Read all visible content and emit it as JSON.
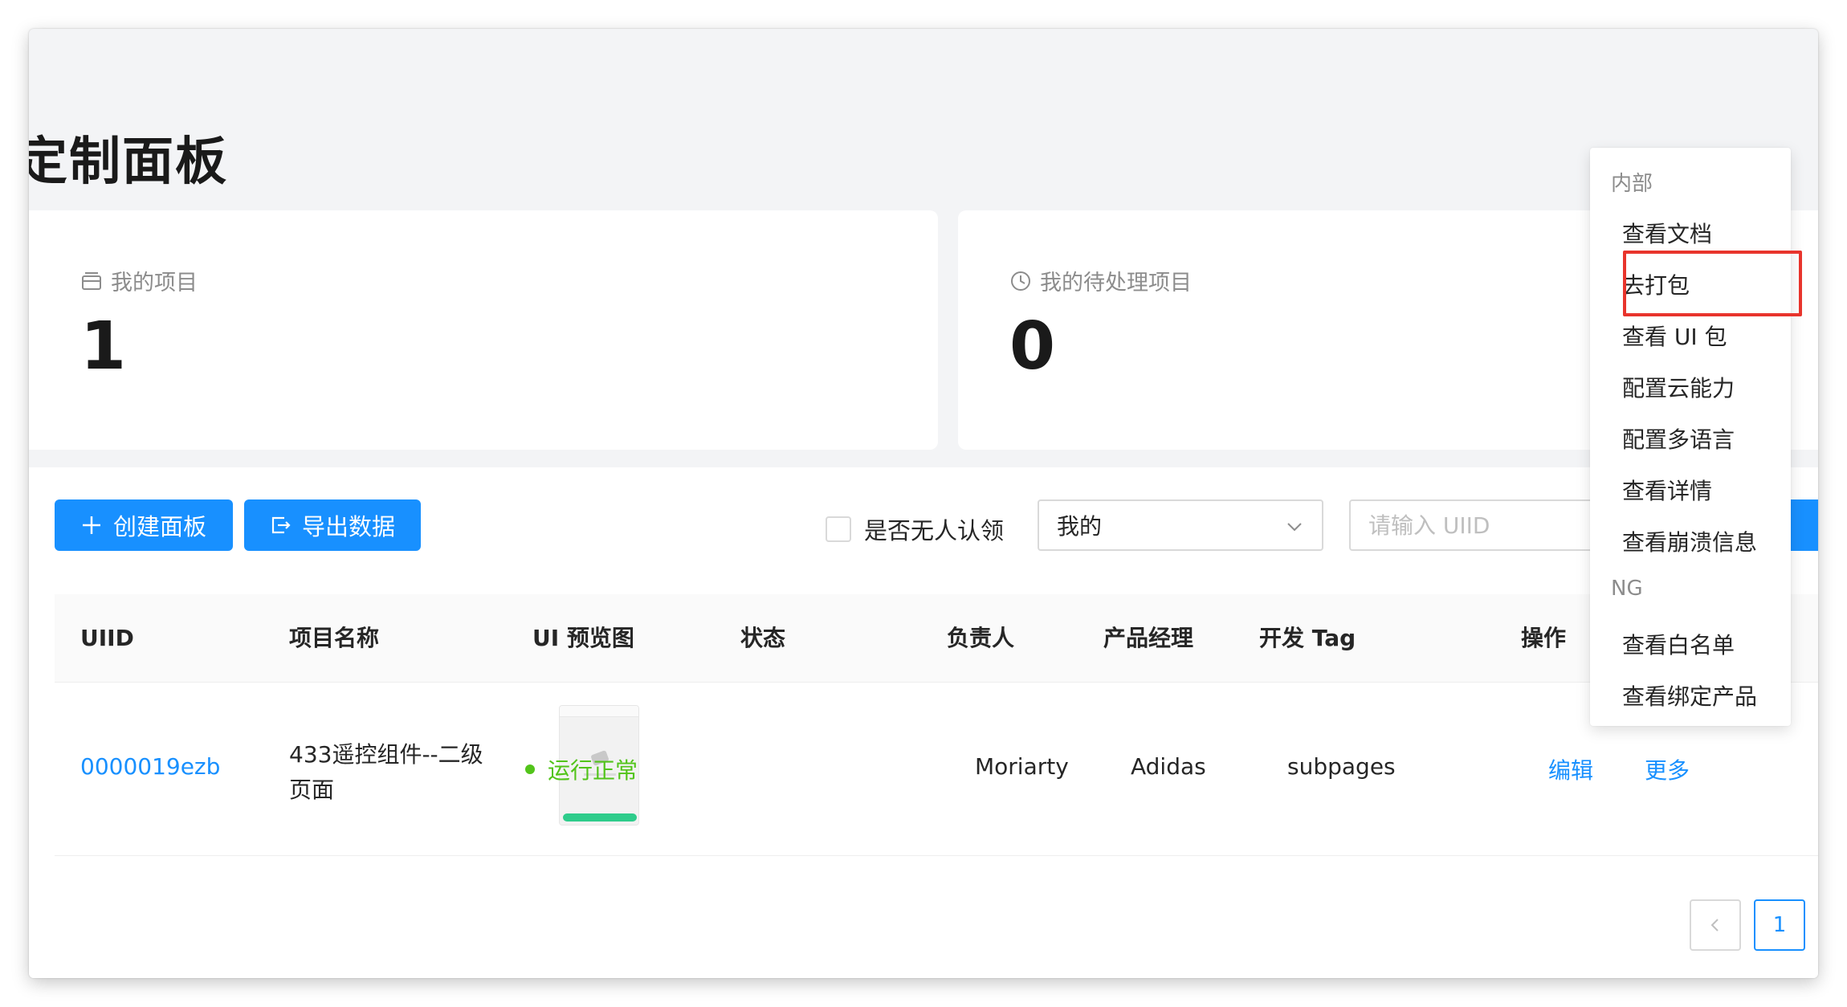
{
  "page": {
    "title": "定制面板"
  },
  "stats": {
    "my_projects": {
      "label": "我的项目",
      "value": "1"
    },
    "pending": {
      "label": "我的待处理项目",
      "value": "0"
    }
  },
  "toolbar": {
    "create_label": "创建面板",
    "export_label": "导出数据",
    "unclaimed_label": "是否无人认领",
    "scope_select": {
      "value": "我的"
    },
    "uid_placeholder": "请输入 UIID"
  },
  "table": {
    "headers": [
      "UIID",
      "项目名称",
      "UI 预览图",
      "状态",
      "负责人",
      "产品经理",
      "开发 Tag",
      "操作"
    ],
    "rows": [
      {
        "uiid": "0000019ezb",
        "name": "433遥控组件--二级页面",
        "status": "运行正常",
        "owner": "Moriarty",
        "pm": "Adidas",
        "dev_tag": "subpages",
        "edit": "编辑",
        "more": "更多"
      }
    ]
  },
  "pagination": {
    "current": "1"
  },
  "dropdown": {
    "groups": [
      {
        "title": "内部",
        "items": [
          "查看文档",
          "去打包",
          "查看 UI 包",
          "配置云能力",
          "配置多语言",
          "查看详情",
          "查看崩溃信息"
        ]
      },
      {
        "title": "NG",
        "items": [
          "查看白名单",
          "查看绑定产品"
        ]
      }
    ],
    "highlighted_item": "去打包"
  },
  "colors": {
    "primary": "#1890ff",
    "success": "#52c41a",
    "highlight": "#e8342c"
  }
}
